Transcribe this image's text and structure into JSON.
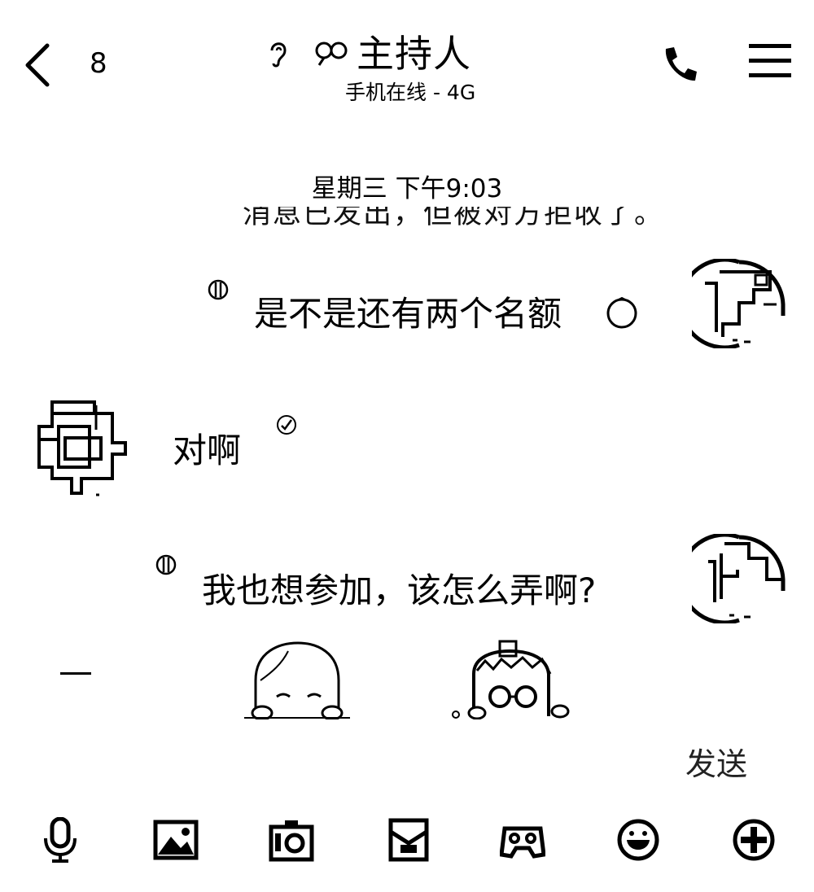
{
  "header": {
    "unread_count": "8",
    "title": "主持人",
    "status": "手机在线 - 4G"
  },
  "chat": {
    "timestamp": "星期三 下午9:03",
    "partial_text": "消息已发出，但被对方拒收了。",
    "messages": [
      {
        "side": "right",
        "text": "是不是还有两个名额"
      },
      {
        "side": "left",
        "text": "对啊"
      },
      {
        "side": "right",
        "text": "我也想参加，该怎么弄啊?"
      }
    ]
  },
  "input": {
    "send_label": "发送"
  },
  "icons": {
    "back": "chevron-left-icon",
    "ear": "ear-icon",
    "link": "link-icon",
    "phone": "phone-icon",
    "menu": "hamburger-menu-icon",
    "toolbar": [
      "microphone-icon",
      "image-icon",
      "camera-icon",
      "red-packet-icon",
      "gamepad-icon",
      "emoji-icon",
      "plus-icon"
    ]
  }
}
